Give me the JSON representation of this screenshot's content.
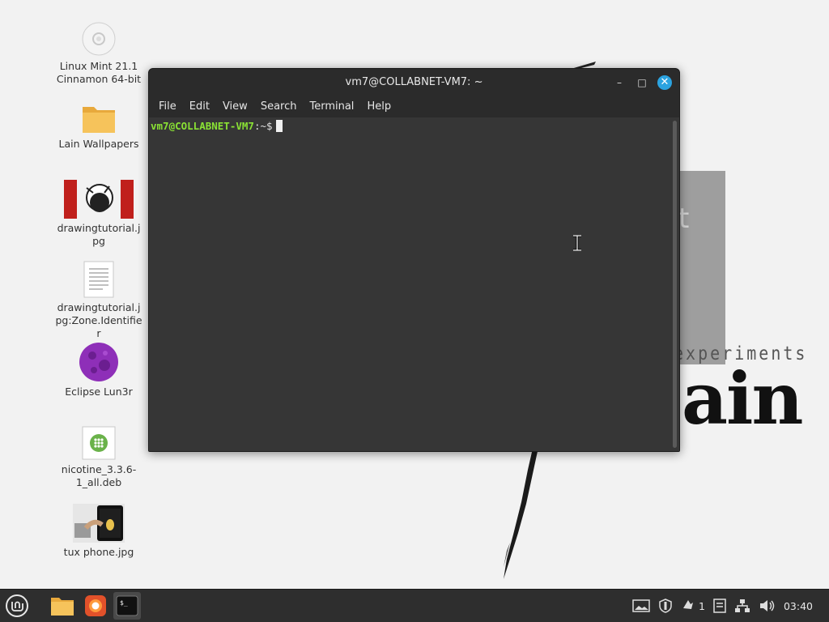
{
  "desktop": {
    "icons": [
      {
        "label": "Linux Mint 21.1 Cinnamon 64-bit",
        "icon": "disc-icon"
      },
      {
        "label": "Lain Wallpapers",
        "icon": "folder-icon"
      },
      {
        "label": "drawingtutorial.jpg",
        "icon": "image-thumbnail-icon"
      },
      {
        "label": "drawingtutorial.jpg:Zone.Identifier",
        "icon": "text-file-icon"
      },
      {
        "label": "Eclipse Lun3r",
        "icon": "moon-icon"
      },
      {
        "label": "nicotine_3.3.6-1_all.deb",
        "icon": "deb-package-icon"
      },
      {
        "label": "tux phone.jpg",
        "icon": "image-thumbnail-icon"
      }
    ]
  },
  "wallpaper": {
    "letter": "t",
    "subtitle": "experiments",
    "big_text": "ain"
  },
  "terminal": {
    "title": "vm7@COLLABNET-VM7: ~",
    "menu": [
      "File",
      "Edit",
      "View",
      "Search",
      "Terminal",
      "Help"
    ],
    "prompt_user": "vm7@COLLABNET-VM7",
    "prompt_path": ":~$",
    "close_glyph": "✕",
    "min_glyph": "–",
    "max_glyph": "□"
  },
  "taskbar": {
    "launchers": [
      {
        "name": "mint-menu-icon"
      },
      {
        "name": "files-icon"
      },
      {
        "name": "firefox-icon"
      },
      {
        "name": "terminal-icon",
        "active": true,
        "label": "$_"
      }
    ],
    "tray": {
      "update_count": "1",
      "clock": "03:40"
    }
  }
}
